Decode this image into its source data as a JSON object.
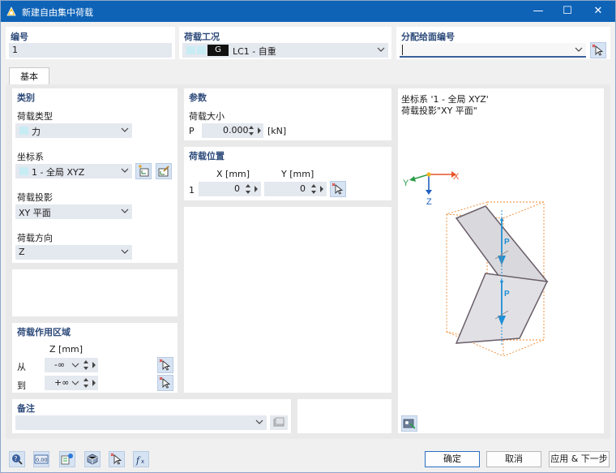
{
  "window": {
    "title": "新建自由集中荷载",
    "minimize": "—",
    "maximize": "☐",
    "close": "✕"
  },
  "header": {
    "id_label": "编号",
    "id_value": "1",
    "loadcase_label": "荷载工况",
    "loadcase_tag": "G",
    "loadcase_value": "LC1 - 自重",
    "assign_label": "分配给面编号",
    "assign_value": ""
  },
  "tabs": [
    {
      "label": "基本"
    }
  ],
  "category": {
    "title": "类别",
    "load_type_label": "荷载类型",
    "load_type_value": "力",
    "coord_label": "坐标系",
    "coord_value": "1 - 全局 XYZ",
    "projection_label": "荷载投影",
    "projection_value": "XY 平面",
    "direction_label": "荷载方向",
    "direction_value": "Z"
  },
  "parameters": {
    "title": "参数",
    "magnitude_label": "荷载大小",
    "p_symbol": "P",
    "p_value": "0.000",
    "p_unit": "[kN]"
  },
  "position": {
    "title": "荷载位置",
    "x_header": "X [mm]",
    "y_header": "Y [mm]",
    "rows": [
      {
        "index": "1",
        "x": "0",
        "y": "0"
      }
    ]
  },
  "region": {
    "title": "荷载作用区域",
    "z_header": "Z [mm]",
    "from_label": "从",
    "from_value": "-∞",
    "to_label": "到",
    "to_value": "+∞"
  },
  "comment": {
    "label": "备注",
    "value": ""
  },
  "preview": {
    "coord_text": "坐标系 '1 - 全局 XYZ'",
    "projection_text": "荷载投影\"XY 平面\"",
    "axis_x": "X",
    "axis_y": "Y",
    "axis_z": "Z",
    "load_label": "P"
  },
  "footer": {
    "ok": "确定",
    "cancel": "取消",
    "apply_next": "应用 & 下一步"
  },
  "colors": {
    "titlebar": "#0e63b7",
    "accent": "#1e90d8",
    "axis_x": "#e8542a",
    "axis_y": "#2a9d4a",
    "axis_z": "#2060c0"
  }
}
